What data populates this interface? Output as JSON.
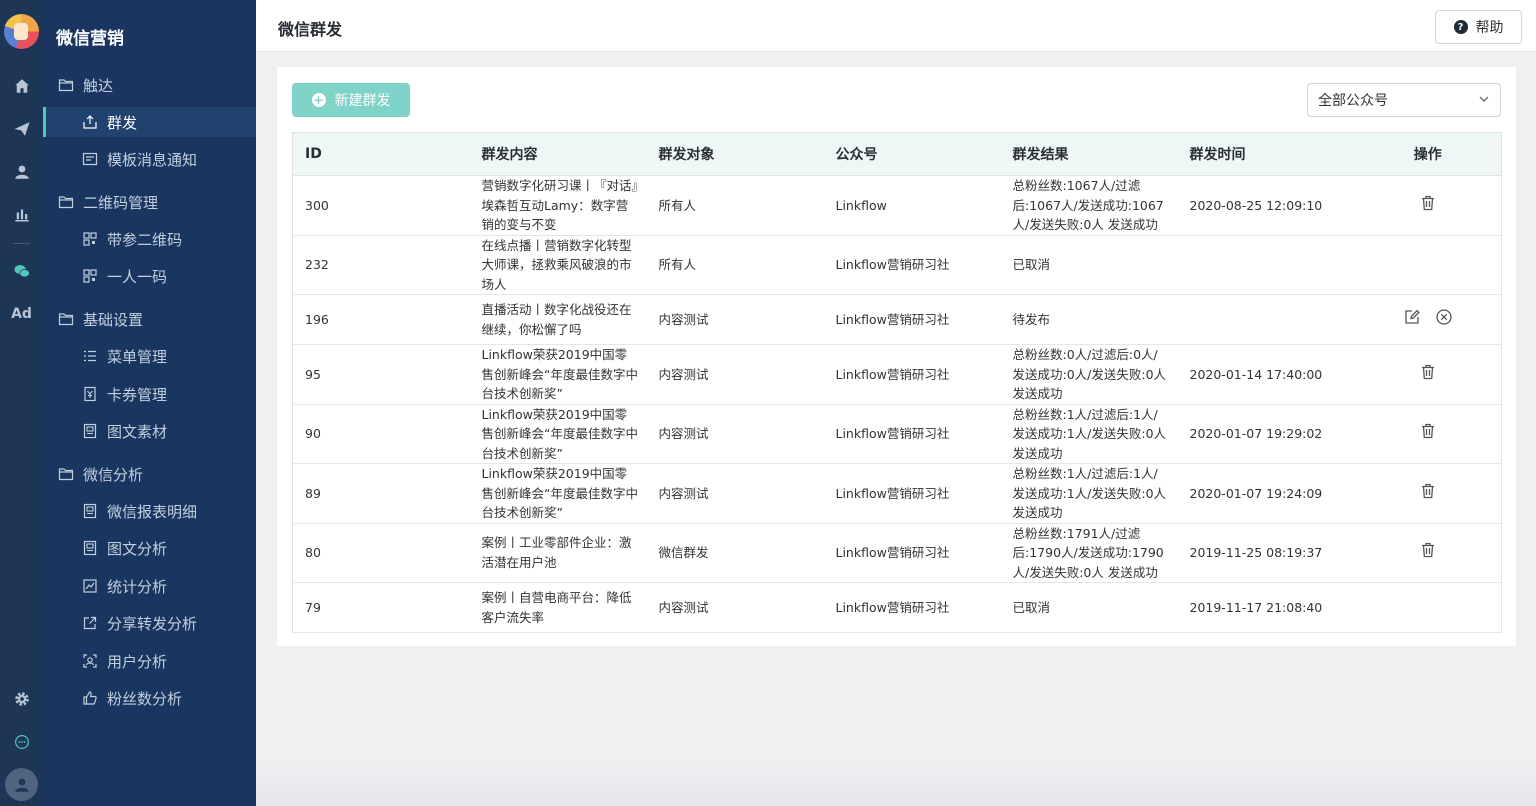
{
  "app": {
    "brand": "微信营销",
    "page_title": "微信群发",
    "help_label": "帮助"
  },
  "rail": {
    "icons": [
      "home-icon",
      "send-icon",
      "user-icon",
      "bar-chart-icon",
      "wechat-icon",
      "ad-icon",
      "settings-icon",
      "chat-bubble-icon",
      "avatar-icon"
    ],
    "ad_label": "Ad"
  },
  "sidebar": {
    "groups": [
      {
        "label": "触达",
        "items": [
          {
            "label": "群发",
            "active": true
          },
          {
            "label": "模板消息通知"
          }
        ]
      },
      {
        "label": "二维码管理",
        "items": [
          {
            "label": "带参二维码"
          },
          {
            "label": "一人一码"
          }
        ]
      },
      {
        "label": "基础设置",
        "items": [
          {
            "label": "菜单管理"
          },
          {
            "label": "卡券管理"
          },
          {
            "label": "图文素材"
          }
        ]
      },
      {
        "label": "微信分析",
        "items": [
          {
            "label": "微信报表明细"
          },
          {
            "label": "图文分析"
          },
          {
            "label": "统计分析"
          },
          {
            "label": "分享转发分析"
          },
          {
            "label": "用户分析"
          },
          {
            "label": "粉丝数分析"
          }
        ]
      }
    ]
  },
  "toolbar": {
    "new_label": "新建群发",
    "account_filter": "全部公众号"
  },
  "table": {
    "columns": [
      "ID",
      "群发内容",
      "群发对象",
      "公众号",
      "群发结果",
      "群发时间",
      "操作"
    ],
    "rows": [
      {
        "id": "300",
        "content": "营销数字化研习课丨『对话』埃森哲互动Lamy：数字营销的变与不变",
        "target": "所有人",
        "account": "Linkflow",
        "result": "总粉丝数:1067人/过滤后:1067人/发送成功:1067人/发送失败:0人 发送成功",
        "time": "2020-08-25 12:09:10",
        "actions": [
          "delete"
        ]
      },
      {
        "id": "232",
        "content": "在线点播丨营销数字化转型大师课，拯救乘风破浪的市场人",
        "target": "所有人",
        "account": "Linkflow营销研习社",
        "result": "已取消",
        "time": "",
        "actions": []
      },
      {
        "id": "196",
        "content": "直播活动丨数字化战役还在继续，你松懈了吗",
        "target": "内容测试",
        "account": "Linkflow营销研习社",
        "result": "待发布",
        "time": "",
        "actions": [
          "edit",
          "cancel"
        ]
      },
      {
        "id": "95",
        "content": "Linkflow荣获2019中国零售创新峰会“年度最佳数字中台技术创新奖”",
        "target": "内容测试",
        "account": "Linkflow营销研习社",
        "result": "总粉丝数:0人/过滤后:0人/发送成功:0人/发送失败:0人 发送成功",
        "time": "2020-01-14 17:40:00",
        "actions": [
          "delete"
        ]
      },
      {
        "id": "90",
        "content": "Linkflow荣获2019中国零售创新峰会“年度最佳数字中台技术创新奖”",
        "target": "内容测试",
        "account": "Linkflow营销研习社",
        "result": "总粉丝数:1人/过滤后:1人/发送成功:1人/发送失败:0人 发送成功",
        "time": "2020-01-07 19:29:02",
        "actions": [
          "delete"
        ]
      },
      {
        "id": "89",
        "content": "Linkflow荣获2019中国零售创新峰会“年度最佳数字中台技术创新奖”",
        "target": "内容测试",
        "account": "Linkflow营销研习社",
        "result": "总粉丝数:1人/过滤后:1人/发送成功:1人/发送失败:0人 发送成功",
        "time": "2020-01-07 19:24:09",
        "actions": [
          "delete"
        ]
      },
      {
        "id": "80",
        "content": "案例丨工业零部件企业：激活潜在用户池",
        "target": "微信群发",
        "account": "Linkflow营销研习社",
        "result": "总粉丝数:1791人/过滤后:1790人/发送成功:1790人/发送失败:0人 发送成功",
        "time": "2019-11-25 08:19:37",
        "actions": [
          "delete"
        ]
      },
      {
        "id": "79",
        "content": "案例丨自营电商平台：降低客户流失率",
        "target": "内容测试",
        "account": "Linkflow营销研习社",
        "result": "已取消",
        "time": "2019-11-17 21:08:40",
        "actions": []
      }
    ]
  },
  "colors": {
    "rail_bg": "#1d3656",
    "sidebar_bg": "#1a3660",
    "accent": "#4ec9bb",
    "primary_button": "#7fd3c8",
    "table_header_bg": "#eff7f6"
  }
}
